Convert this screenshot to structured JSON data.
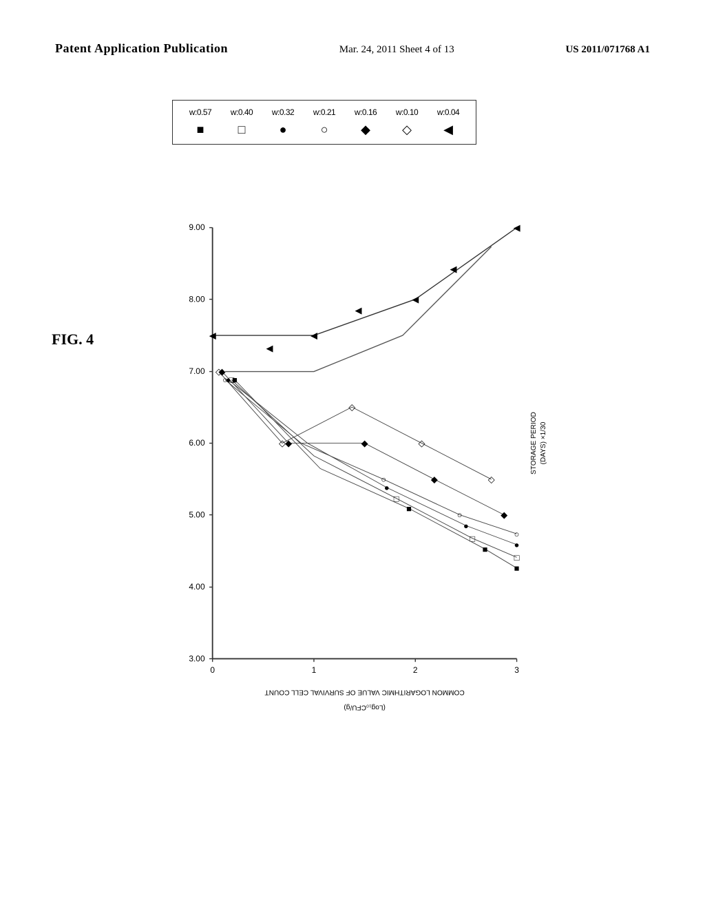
{
  "header": {
    "left": "Patent Application Publication",
    "center": "Mar. 24, 2011  Sheet 4 of 13",
    "right": "US 2011/071768 A1"
  },
  "fig_label": "FIG. 4",
  "legend": {
    "items": [
      {
        "label": "w:0.57",
        "symbol": "■",
        "type": "filled-square"
      },
      {
        "label": "w:0.40",
        "symbol": "□",
        "type": "open-square"
      },
      {
        "label": "w:0.32",
        "symbol": "●",
        "type": "filled-circle"
      },
      {
        "label": "w:0.21",
        "symbol": "○",
        "type": "open-circle"
      },
      {
        "label": "w:0.16",
        "symbol": "◆",
        "type": "filled-diamond"
      },
      {
        "label": "w:0.10",
        "symbol": "◇",
        "type": "open-diamond"
      },
      {
        "label": "w:0.04",
        "symbol": "◀",
        "type": "filled-triangle"
      }
    ]
  },
  "chart": {
    "y_axis_label": "COMMON LOGARITHMIC VALUE OF SURVIVAL CELL COUNT",
    "y_axis_sub": "(Log₁₀CFU/g)",
    "x_axis_label": "STORAGE PERIOD",
    "x_axis_sub": "(DAYS) ×1/30",
    "y_ticks": [
      "9.00",
      "8.00",
      "7.00",
      "6.00",
      "5.00",
      "4.00",
      "3.00"
    ],
    "x_ticks": [
      "0",
      "1",
      "2",
      "3"
    ],
    "title": "FIG. 4"
  },
  "colors": {
    "background": "#ffffff",
    "border": "#333333",
    "text": "#000000"
  }
}
